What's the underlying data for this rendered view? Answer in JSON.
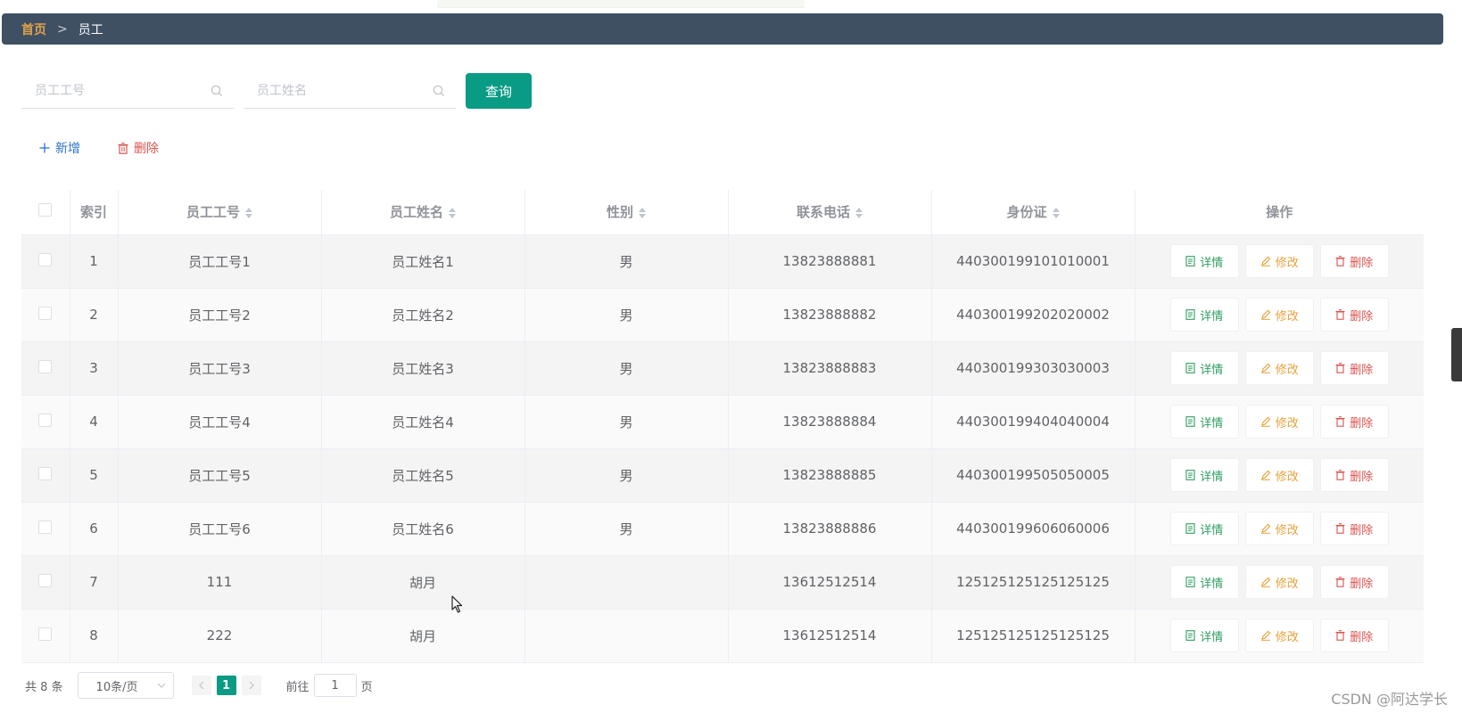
{
  "breadcrumb": {
    "home": "首页",
    "separator": ">",
    "current": "员工"
  },
  "search": {
    "id_placeholder": "员工工号",
    "name_placeholder": "员工姓名",
    "query_label": "查询"
  },
  "actions": {
    "add_label": "新增",
    "delete_label": "删除"
  },
  "table": {
    "headers": {
      "index": "索引",
      "emp_id": "员工工号",
      "emp_name": "员工姓名",
      "gender": "性别",
      "phone": "联系电话",
      "id_card": "身份证",
      "ops": "操作"
    },
    "op_labels": {
      "detail": "详情",
      "edit": "修改",
      "delete": "删除"
    },
    "rows": [
      {
        "index": "1",
        "emp_id": "员工工号1",
        "emp_name": "员工姓名1",
        "gender": "男",
        "phone": "13823888881",
        "id_card": "440300199101010001"
      },
      {
        "index": "2",
        "emp_id": "员工工号2",
        "emp_name": "员工姓名2",
        "gender": "男",
        "phone": "13823888882",
        "id_card": "440300199202020002"
      },
      {
        "index": "3",
        "emp_id": "员工工号3",
        "emp_name": "员工姓名3",
        "gender": "男",
        "phone": "13823888883",
        "id_card": "440300199303030003"
      },
      {
        "index": "4",
        "emp_id": "员工工号4",
        "emp_name": "员工姓名4",
        "gender": "男",
        "phone": "13823888884",
        "id_card": "440300199404040004"
      },
      {
        "index": "5",
        "emp_id": "员工工号5",
        "emp_name": "员工姓名5",
        "gender": "男",
        "phone": "13823888885",
        "id_card": "440300199505050005"
      },
      {
        "index": "6",
        "emp_id": "员工工号6",
        "emp_name": "员工姓名6",
        "gender": "男",
        "phone": "13823888886",
        "id_card": "440300199606060006"
      },
      {
        "index": "7",
        "emp_id": "111",
        "emp_name": "胡月",
        "gender": "",
        "phone": "13612512514",
        "id_card": "125125125125125125"
      },
      {
        "index": "8",
        "emp_id": "222",
        "emp_name": "胡月",
        "gender": "",
        "phone": "13612512514",
        "id_card": "125125125125125125"
      }
    ]
  },
  "pagination": {
    "total": "共 8 条",
    "page_size": "10条/页",
    "current_page": "1",
    "goto_label": "前往",
    "goto_value": "1",
    "page_unit": "页"
  },
  "watermark": "CSDN @阿达学长",
  "colors": {
    "header_bar": "#3f5063",
    "accent": "#0a9b84",
    "home_link": "#e0a24a",
    "add": "#2a73c8",
    "danger": "#d9534f",
    "edit": "#e6a23c",
    "detail": "#2f9c62"
  },
  "icons": {
    "search": "magnifier-icon",
    "add": "plus-icon",
    "delete": "trash-icon",
    "detail": "document-icon",
    "edit": "pencil-icon"
  }
}
